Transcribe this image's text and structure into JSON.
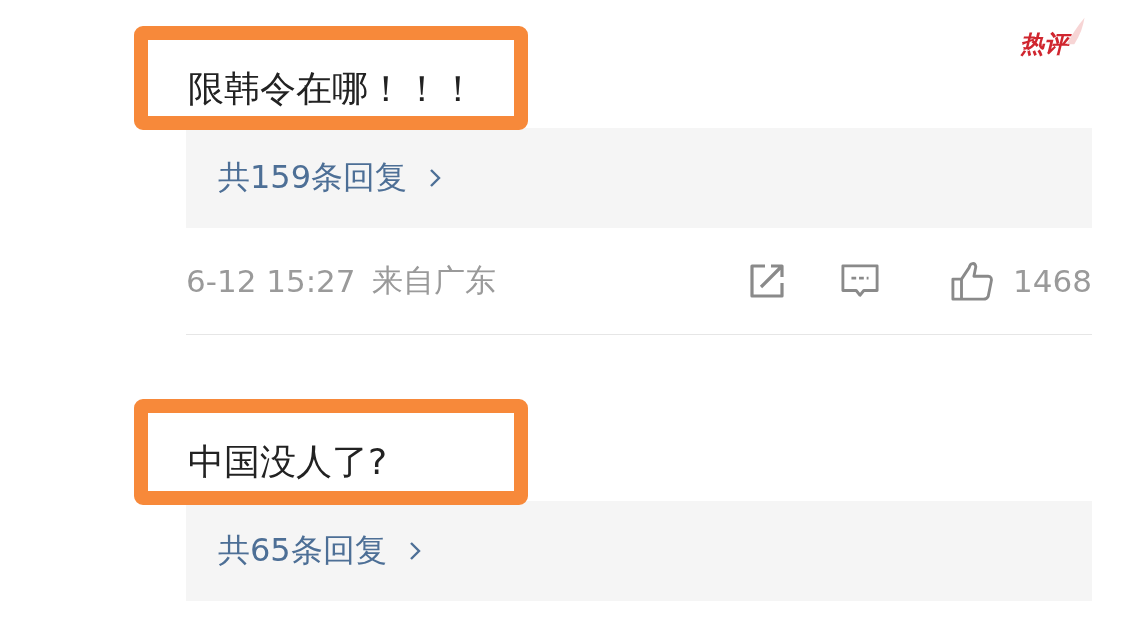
{
  "badge": {
    "text": "热评"
  },
  "comments": [
    {
      "text": "限韩令在哪！！！",
      "highlighted": true,
      "replies": "共159条回复",
      "meta": {
        "time": "6-12 15:27",
        "location": "来自广东",
        "likes": "1468"
      }
    },
    {
      "text": "中国没人了?",
      "highlighted": true,
      "replies": "共65条回复"
    }
  ]
}
